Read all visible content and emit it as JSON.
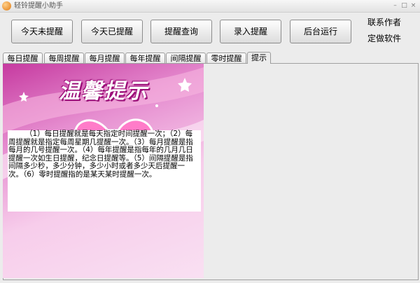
{
  "window": {
    "title": "轻铃提醒小助手"
  },
  "toolbar": {
    "buttons": [
      {
        "label": "今天未提醒"
      },
      {
        "label": "今天已提醒"
      },
      {
        "label": "提醒查询"
      },
      {
        "label": "录入提醒"
      },
      {
        "label": "后台运行"
      }
    ],
    "contact_author": "联系作者",
    "custom_software": "定做软件"
  },
  "tabs": [
    {
      "label": "每日提醒"
    },
    {
      "label": "每周提醒"
    },
    {
      "label": "每月提醒"
    },
    {
      "label": "每年提醒"
    },
    {
      "label": "间隔提醒"
    },
    {
      "label": "零时提醒"
    },
    {
      "label": "提示",
      "active": true
    }
  ],
  "banner": {
    "text": "温馨提示"
  },
  "hint": {
    "text": "（1）每日提醒就是每天指定时间提醒一次；（2）每周提醒就是指定每周星期几提醒一次。（3）每月提醒是指每月的几号提醒一次。（4）每年提醒是指每年的几月几日提醒一次如生日提醒，纪念日提醒等。（5）间隔提醒是指间隔多少秒，多少分钟，多少小时或者多少天后提醒一次。（6）零时提醒指的是某天某时提醒一次。"
  },
  "colors": {
    "art_magenta": "#c63aa0",
    "art_pink": "#f7cdeb"
  }
}
